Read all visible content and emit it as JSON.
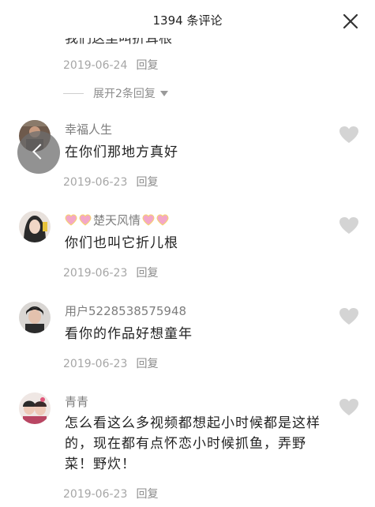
{
  "header": {
    "title": "1394 条评论"
  },
  "previous": {
    "cut_text": "我们这里叫折耳根",
    "date": "2019-06-24",
    "reply": "回复"
  },
  "expand": {
    "label": "展开2条回复"
  },
  "comments": [
    {
      "username": "幸福人生",
      "text": "在你们那地方真好",
      "date": "2019-06-23",
      "reply": "回复"
    },
    {
      "username": "楚天风情",
      "text": "你们也叫它折儿根",
      "date": "2019-06-23",
      "reply": "回复"
    },
    {
      "username": "用户5228538575948",
      "text": "看你的作品好想童年",
      "date": "2019-06-23",
      "reply": "回复"
    },
    {
      "username": "青青",
      "text": "怎么看这么多视频都想起小时候都是这样的，现在都有点怀恋小时候抓鱼，弄野菜！野炊！",
      "date": "2019-06-23",
      "reply": "回复"
    }
  ],
  "colors": {
    "like_icon": "#d4d4d4",
    "meta_text": "#a6a6a6",
    "heart_emoji": "#f3a7c8"
  },
  "icons": [
    "close-icon",
    "heart-icon",
    "back-chevron-icon",
    "chevron-down-icon"
  ]
}
